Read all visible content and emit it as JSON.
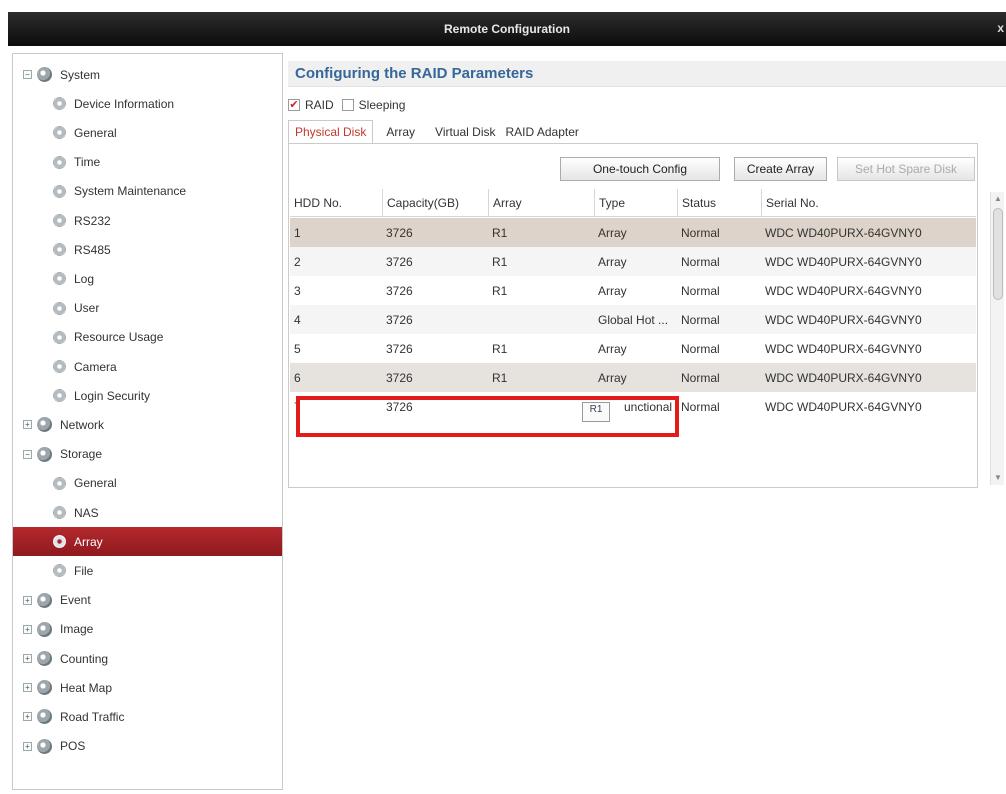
{
  "window": {
    "title": "Remote Configuration",
    "close_glyph": "x"
  },
  "sidebar": {
    "items": [
      {
        "label": "System",
        "level": 0,
        "expander": "−"
      },
      {
        "label": "Device Information",
        "level": 1
      },
      {
        "label": "General",
        "level": 1
      },
      {
        "label": "Time",
        "level": 1
      },
      {
        "label": "System Maintenance",
        "level": 1
      },
      {
        "label": "RS232",
        "level": 1
      },
      {
        "label": "RS485",
        "level": 1
      },
      {
        "label": "Log",
        "level": 1
      },
      {
        "label": "User",
        "level": 1
      },
      {
        "label": "Resource Usage",
        "level": 1
      },
      {
        "label": "Camera",
        "level": 1
      },
      {
        "label": "Login Security",
        "level": 1
      },
      {
        "label": "Network",
        "level": 0,
        "expander": "+"
      },
      {
        "label": "Storage",
        "level": 0,
        "expander": "−"
      },
      {
        "label": "General",
        "level": 1
      },
      {
        "label": "NAS",
        "level": 1
      },
      {
        "label": "Array",
        "level": 1,
        "selected": true
      },
      {
        "label": "File",
        "level": 1
      },
      {
        "label": "Event",
        "level": 0,
        "expander": "+"
      },
      {
        "label": "Image",
        "level": 0,
        "expander": "+"
      },
      {
        "label": "Counting",
        "level": 0,
        "expander": "+"
      },
      {
        "label": "Heat Map",
        "level": 0,
        "expander": "+"
      },
      {
        "label": "Road Traffic",
        "level": 0,
        "expander": "+"
      },
      {
        "label": "POS",
        "level": 0,
        "expander": "+"
      }
    ]
  },
  "main": {
    "title": "Configuring the RAID Parameters",
    "checkboxes": {
      "raid": {
        "label": "RAID",
        "checked": true,
        "mark": "✔"
      },
      "sleeping": {
        "label": "Sleeping",
        "checked": false
      }
    },
    "tabs": [
      "Physical Disk",
      "Array",
      "Virtual Disk",
      "RAID Adapter"
    ],
    "active_tab": "Physical Disk",
    "buttons": {
      "one_touch": "One-touch Config",
      "create_array": "Create Array",
      "set_hot_spare": "Set Hot Spare Disk"
    },
    "table": {
      "headers": [
        "HDD No.",
        "Capacity(GB)",
        "Array",
        "Type",
        "Status",
        "Serial No."
      ],
      "rows": [
        [
          "1",
          "3726",
          "R1",
          "Array",
          "Normal",
          "WDC WD40PURX-64GVNY0"
        ],
        [
          "2",
          "3726",
          "R1",
          "Array",
          "Normal",
          "WDC WD40PURX-64GVNY0"
        ],
        [
          "3",
          "3726",
          "R1",
          "Array",
          "Normal",
          "WDC WD40PURX-64GVNY0"
        ],
        [
          "4",
          "3726",
          "",
          "Global Hot ...",
          "Normal",
          "WDC WD40PURX-64GVNY0"
        ],
        [
          "5",
          "3726",
          "R1",
          "Array",
          "Normal",
          "WDC WD40PURX-64GVNY0"
        ],
        [
          "6",
          "3726",
          "R1",
          "Array",
          "Normal",
          "WDC WD40PURX-64GVNY0"
        ],
        [
          "7",
          "3726",
          "",
          "unctional",
          "Normal",
          "WDC WD40PURX-64GVNY0"
        ]
      ]
    },
    "row7_dropdown_value": "R1"
  },
  "colors": {
    "title_blue": "#36679a",
    "selected_bg": "#9f2025",
    "annotation_red": "#e21b1b",
    "active_tab_text": "#c0392b",
    "highlight_row": "#ded3ca"
  },
  "icons": {
    "category": "globe-icon",
    "leaf": "gear-icon"
  }
}
